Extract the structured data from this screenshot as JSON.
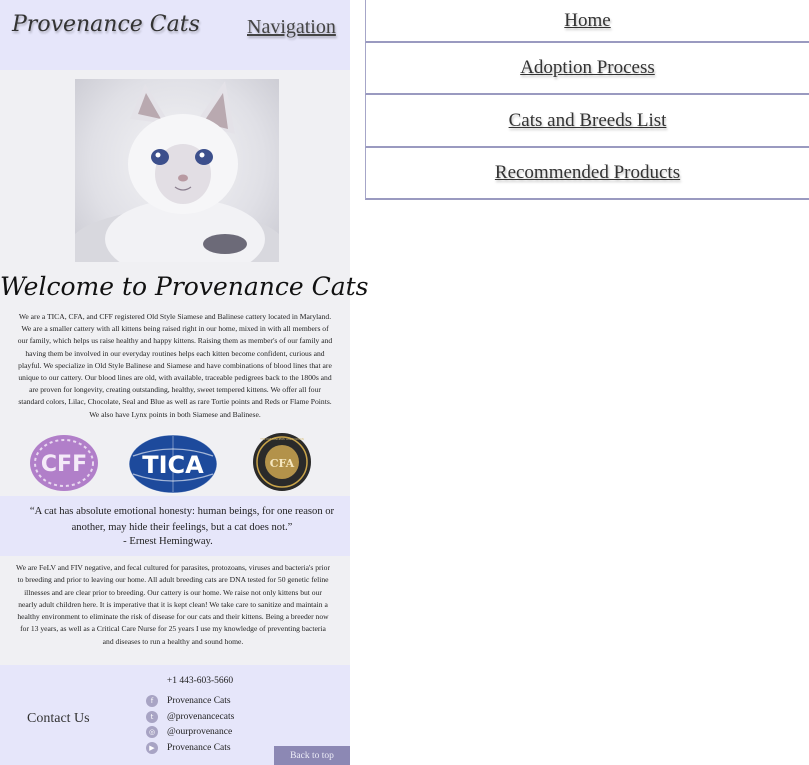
{
  "header": {
    "logo": "Provenance Cats",
    "nav_toggle": "Navigation"
  },
  "nav": {
    "items": [
      {
        "label": "Home"
      },
      {
        "label": "Adoption Process"
      },
      {
        "label": "Cats and Breeds List"
      },
      {
        "label": "Recommended Products"
      }
    ]
  },
  "hero": {
    "alt": "White kitten with blue eyes"
  },
  "welcome": {
    "title": "Welcome to Provenance Cats",
    "intro": "We are a TICA, CFA, and CFF registered Old Style Siamese and Balinese cattery located in Maryland. We are a smaller cattery with all kittens being raised right in our home, mixed in with all members of our family, which helps us raise healthy and happy kittens. Raising them as member's of our family and having them be involved in our everyday routines helps each kitten become confident, curious and playful. We specialize in Old Style Balinese and Siamese and have combinations of blood lines that are unique to our cattery. Our blood lines are old, with available, traceable pedigrees back to the 1800s and are proven for longevity, creating outstanding, healthy, sweet tempered kittens.  We offer all four standard colors, Lilac, Chocolate, Seal and Blue as well as rare Tortie points and Reds or Flame Points.  We also have Lynx points in both Siamese and Balinese."
  },
  "badges": {
    "cff": "CFF",
    "tica": "TICA",
    "cfa": "CFA",
    "cfa_ring": "THE CAT FANCIERS' ASSOCIATION"
  },
  "quote": {
    "text": "“A cat has absolute emotional honesty: human beings, for one reason or another, may hide their feelings, but a cat does not.”",
    "author": "- Ernest Hemingway."
  },
  "health": {
    "text": "We are FeLV and FIV negative, and fecal cultured for parasites, protozoans, viruses and bacteria's prior to breeding and prior to leaving our home. All adult breeding cats are DNA tested for 50 genetic feline illnesses and are clear prior to breeding. Our cattery is our home. We raise not only kittens but our nearly adult children here. It is imperative that it is kept clean! We take care to sanitize and maintain a healthy environment to eliminate the risk of disease for our cats and their kittens. Being a breeder now for 13 years, as well as a Critical Care Nurse for 25 years I use my knowledge of preventing bacteria and diseases to run a healthy and sound home."
  },
  "footer": {
    "phone": "+1 443-603-5660",
    "contact_label": "Contact Us",
    "social": [
      {
        "icon": "facebook-icon",
        "label": "Provenance Cats"
      },
      {
        "icon": "twitter-icon",
        "label": "@provenancecats"
      },
      {
        "icon": "instagram-icon",
        "label": "@ourprovenance"
      },
      {
        "icon": "youtube-icon",
        "label": "Provenance Cats"
      }
    ],
    "back_to_top": "Back to top"
  }
}
